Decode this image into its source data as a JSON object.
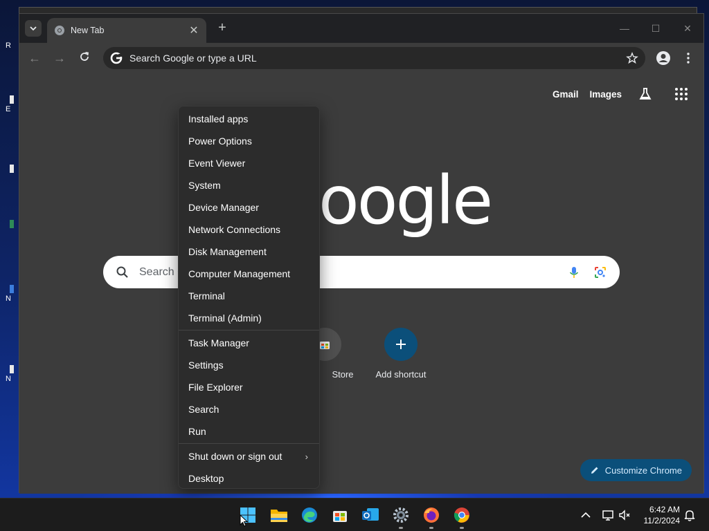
{
  "desktop": {
    "icon_labels": [
      "R",
      "E",
      "N",
      "N"
    ]
  },
  "browser": {
    "tab_title": "New Tab",
    "tab_close": "✕",
    "new_tab": "+",
    "omnibox_placeholder": "Search Google or type a URL",
    "top_links": {
      "gmail": "Gmail",
      "images": "Images"
    },
    "logo_partial": "oogle",
    "search_placeholder_partial": "Search G",
    "shortcuts": [
      {
        "label": "Store",
        "icon": "store-icon"
      },
      {
        "label": "Add shortcut",
        "icon": "plus-icon"
      }
    ],
    "customize_label": "Customize Chrome"
  },
  "context_menu": {
    "group1": [
      "Installed apps",
      "Power Options",
      "Event Viewer",
      "System",
      "Device Manager",
      "Network Connections",
      "Disk Management",
      "Computer Management",
      "Terminal",
      "Terminal (Admin)"
    ],
    "group2": [
      "Task Manager",
      "Settings",
      "File Explorer",
      "Search",
      "Run"
    ],
    "group3": [
      "Shut down or sign out",
      "Desktop"
    ],
    "submenu_arrow": "›"
  },
  "taskbar": {
    "apps": [
      "start-icon",
      "file-explorer-icon",
      "edge-icon",
      "store-icon",
      "outlook-icon",
      "settings-icon",
      "firefox-icon",
      "chrome-icon"
    ],
    "clock_time": "6:42 AM",
    "clock_date": "11/2/2024"
  },
  "colors": {
    "window_bg": "#3c3c3c",
    "titlebar_bg": "#202124",
    "menu_bg": "#2c2c2c",
    "accent": "#0b4f7a",
    "taskbar_bg": "#1c1c1c"
  }
}
